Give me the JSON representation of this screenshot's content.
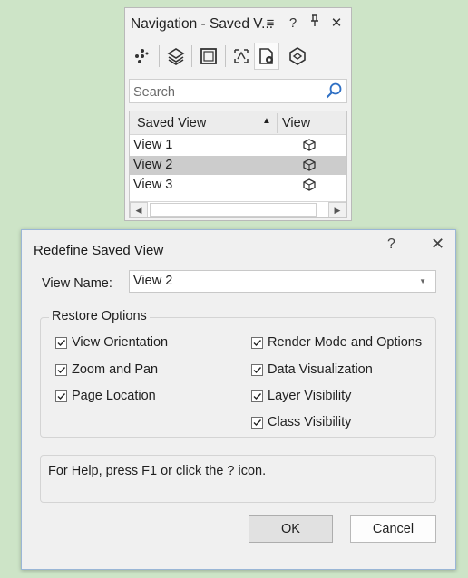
{
  "navigation_palette": {
    "title": "Navigation - Saved V...",
    "title_buttons": [
      "≡",
      "?",
      "⊥",
      "✕"
    ],
    "toolbar_icons": [
      "object-tree-icon",
      "layers-icon",
      "sheets-icon",
      "drawing-icon",
      "saved-views-icon",
      "viewports-icon"
    ],
    "search": {
      "placeholder": "Search",
      "value": ""
    },
    "columns": {
      "saved_view": "Saved View",
      "view": "View",
      "sort": "▲"
    },
    "rows": [
      {
        "label": "View 1",
        "selected": false
      },
      {
        "label": "View 2",
        "selected": true
      },
      {
        "label": "View 3",
        "selected": false
      }
    ],
    "scroll_left": "◀",
    "scroll_right": "▶"
  },
  "dialog": {
    "title": "Redefine Saved View",
    "help_glyph": "?",
    "close_glyph": "✕",
    "view_name_label": "View Name:",
    "view_name_value": "View 2",
    "restore_options_label": "Restore Options",
    "options_left": [
      {
        "label": "View Orientation",
        "checked": true
      },
      {
        "label": "Zoom and Pan",
        "checked": true
      },
      {
        "label": "Page Location",
        "checked": true
      }
    ],
    "options_right": [
      {
        "label": "Render Mode and Options",
        "checked": true
      },
      {
        "label": "Data Visualization",
        "checked": true
      },
      {
        "label": "Layer Visibility",
        "checked": true
      },
      {
        "label": "Class Visibility",
        "checked": true
      }
    ],
    "help_message": "For Help, press F1 or click the ? icon.",
    "ok_label": "OK",
    "cancel_label": "Cancel"
  },
  "colors": {
    "background": "#cde4c7",
    "accent_blue": "#2e6fc4",
    "selection": "#cccccc"
  }
}
